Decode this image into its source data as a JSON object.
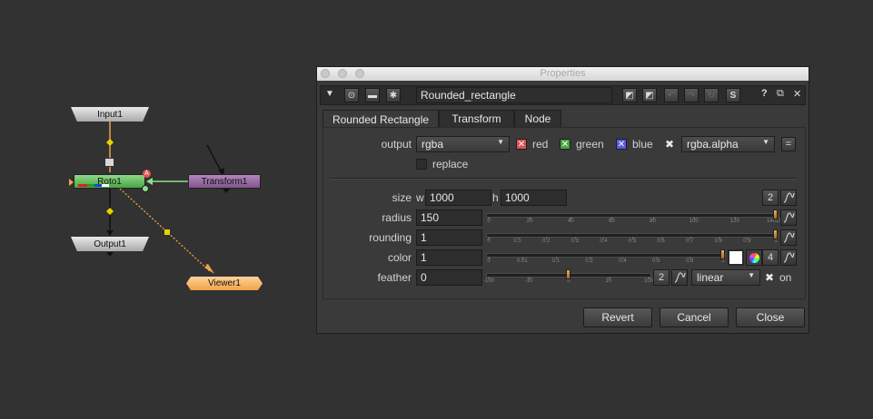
{
  "graph": {
    "nodes": {
      "input": "Input1",
      "roto": "Roto1",
      "transform": "Transform1",
      "output": "Output1",
      "viewer": "Viewer1"
    },
    "roto_badge": "A",
    "viewer_input_number": "1",
    "colors": {
      "input_output": "#c4c4c4",
      "roto": "#6fc468",
      "transform": "#9c6ea7",
      "viewer": "#f4b66a",
      "edge_orange": "#f0a348",
      "edge_green": "#8de08a",
      "edge_yellow": "#e6d400"
    }
  },
  "window": {
    "title": "Properties",
    "node_name": "Rounded_rectangle",
    "toolbar_letter": "S",
    "toolbar_help": "?",
    "tabs": [
      {
        "label": "Rounded Rectangle",
        "active": true
      },
      {
        "label": "Transform",
        "active": false
      },
      {
        "label": "Node",
        "active": false
      }
    ],
    "output": {
      "label": "output",
      "value": "rgba",
      "channels": [
        {
          "label": "red",
          "color": "#e05050"
        },
        {
          "label": "green",
          "color": "#4aa544"
        },
        {
          "label": "blue",
          "color": "#5a5ae0"
        }
      ],
      "alpha_value": "rgba.alpha",
      "eq_button": "="
    },
    "replace_label": "replace",
    "size": {
      "label": "size",
      "w_label": "w",
      "w_value": "1000",
      "h_label": "h",
      "h_value": "1000",
      "count_badge": "2"
    },
    "radius": {
      "label": "radius",
      "value": "150",
      "ticks": [
        "0",
        "20",
        "40",
        "60",
        "80",
        "100",
        "120",
        "140150"
      ],
      "fraction": 1.0
    },
    "rounding": {
      "label": "rounding",
      "value": "1",
      "ticks": [
        "0",
        "0.1",
        "0.2",
        "0.3",
        "0.4",
        "0.5",
        "0.6",
        "0.7",
        "0.8",
        "0.9",
        "1"
      ],
      "fraction": 1.0
    },
    "color": {
      "label": "color",
      "value": "1",
      "ticks": [
        "0",
        "0.01",
        "0.1",
        "0.2",
        "0.4",
        "0.6",
        "0.8",
        "1"
      ],
      "fraction": 1.0,
      "count_badge": "4"
    },
    "feather": {
      "label": "feather",
      "value": "0",
      "ticks": [
        "-100",
        "-10",
        "0",
        "10",
        "100"
      ],
      "fraction": 0.5,
      "count_badge": "2",
      "mode": "linear",
      "on_label": "on"
    },
    "buttons": {
      "revert": "Revert",
      "cancel": "Cancel",
      "close": "Close"
    }
  }
}
